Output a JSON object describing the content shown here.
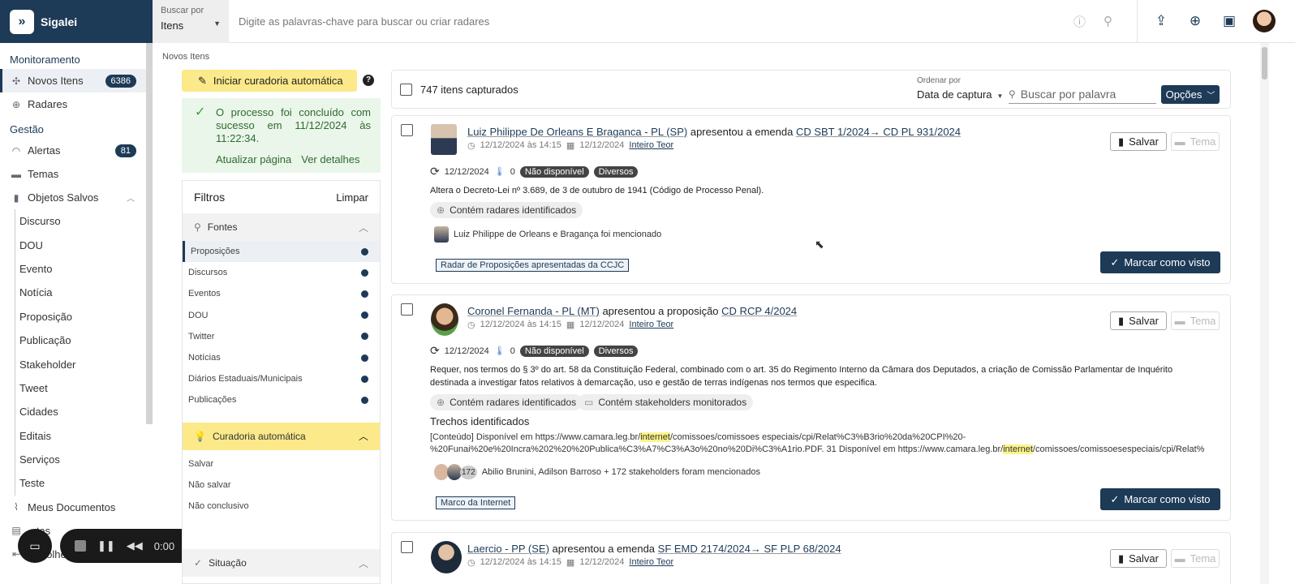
{
  "app": {
    "name": "Sigalei"
  },
  "topbar": {
    "buscar_label": "Buscar por",
    "buscar_value": "Itens",
    "search_placeholder": "Digite as palavras-chave para buscar ou criar radares"
  },
  "sidebar": {
    "section1": "Monitoramento",
    "novos_itens": "Novos Itens",
    "novos_itens_count": "6386",
    "radares": "Radares",
    "section2": "Gestão",
    "alertas": "Alertas",
    "alertas_count": "81",
    "temas": "Temas",
    "objetos_salvos": "Objetos Salvos",
    "subitems": [
      "Discurso",
      "DOU",
      "Evento",
      "Notícia",
      "Proposição",
      "Publicação",
      "Stakeholder",
      "Tweet",
      "Cidades",
      "Editais",
      "Serviços",
      "Teste"
    ],
    "meus_documentos": "Meus Documentos",
    "partial1": "...tas",
    "recolher": "Recolher"
  },
  "recorder": {
    "time": "0:00"
  },
  "breadcrumb": "Novos Itens",
  "curadoria": {
    "button": "Iniciar curadoria automática",
    "success_msg": "O processo foi concluído com sucesso em 11/12/2024 às 11:22:34.",
    "atualizar": "Atualizar página",
    "detalhes": "Ver detalhes"
  },
  "filters": {
    "title": "Filtros",
    "clear": "Limpar",
    "fontes": "Fontes",
    "fontes_items": [
      "Proposições",
      "Discursos",
      "Eventos",
      "DOU",
      "Twitter",
      "Notícias",
      "Diários Estaduais/Municipais",
      "Publicações"
    ],
    "curadoria": "Curadoria automática",
    "curadoria_items": [
      "Salvar",
      "Não salvar",
      "Não conclusivo"
    ],
    "situacao": "Situação"
  },
  "list": {
    "count": "747 itens capturados",
    "order_label": "Ordenar por",
    "order_value": "Data de captura",
    "search_placeholder": "Buscar por palavra",
    "options": "Opções"
  },
  "cards": [
    {
      "author": "Luiz Philippe De Orleans E Braganca - PL (SP)",
      "action": "apresentou a emenda",
      "ref": "CD SBT 1/2024→ CD PL 931/2024",
      "date1": "12/12/2024 às 14:15",
      "date2": "12/12/2024",
      "inteiro": "Inteiro Teor",
      "date3": "12/12/2024",
      "thermo": "0",
      "status": "Não disponível",
      "kind": "Diversos",
      "desc": "Altera o Decreto-Lei nº 3.689, de 3 de outubro de 1941 (Código de Processo Penal).",
      "chip1": "Contém radares identificados",
      "mention": "Luiz Philippe de Orleans e Bragança foi mencionado",
      "tag": "Radar de Proposições apresentadas da CCJC",
      "salvar": "Salvar",
      "tema": "Tema",
      "marcar": "Marcar como visto"
    },
    {
      "author": "Coronel Fernanda - PL (MT)",
      "action": "apresentou a proposição",
      "ref": "CD RCP 4/2024",
      "date1": "12/12/2024 às 14:15",
      "date2": "12/12/2024",
      "inteiro": "Inteiro Teor",
      "date3": "12/12/2024",
      "thermo": "0",
      "status": "Não disponível",
      "kind": "Diversos",
      "desc": "Requer, nos termos do § 3º do art. 58 da Constituição Federal, combinado com o art. 35 do Regimento Interno da Câmara dos Deputados, a criação de Comissão Parlamentar de Inquérito destinada a investigar fatos relativos à demarcação, uso e gestão de terras indígenas nos termos que especifica.",
      "chip1": "Contém radares identificados",
      "chip2": "Contém stakeholders monitorados",
      "trechos": "Trechos identificados",
      "snip_a": "[Conteúdo] Disponível em https://www.camara.leg.br/",
      "snip_hl": "internet",
      "snip_b": "/comissoes/comissoes especiais/cpi/Relat%C3%B3rio%20da%20CPI%20-",
      "snip_c": "%20Funai%20e%20Incra%202%20%20Publica%C3%A7%C3%A3o%20no%20Di%C3%A1rio.PDF. 31 Disponível em https://www.camara.leg.br/",
      "snip_d": "/comissoes/comissoesespeciais/cpi/Relat%",
      "plus": "172",
      "mention": "Abilio Brunini, Adilson Barroso + 172 stakeholders foram mencionados",
      "tag": "Marco da Internet",
      "salvar": "Salvar",
      "tema": "Tema",
      "marcar": "Marcar como visto"
    },
    {
      "author": "Laercio - PP (SE)",
      "action": "apresentou a emenda",
      "ref": "SF EMD 2174/2024→ SF PLP 68/2024",
      "date1": "12/12/2024 às 14:15",
      "date2": "12/12/2024",
      "inteiro": "Inteiro Teor",
      "salvar": "Salvar",
      "tema": "Tema"
    }
  ]
}
